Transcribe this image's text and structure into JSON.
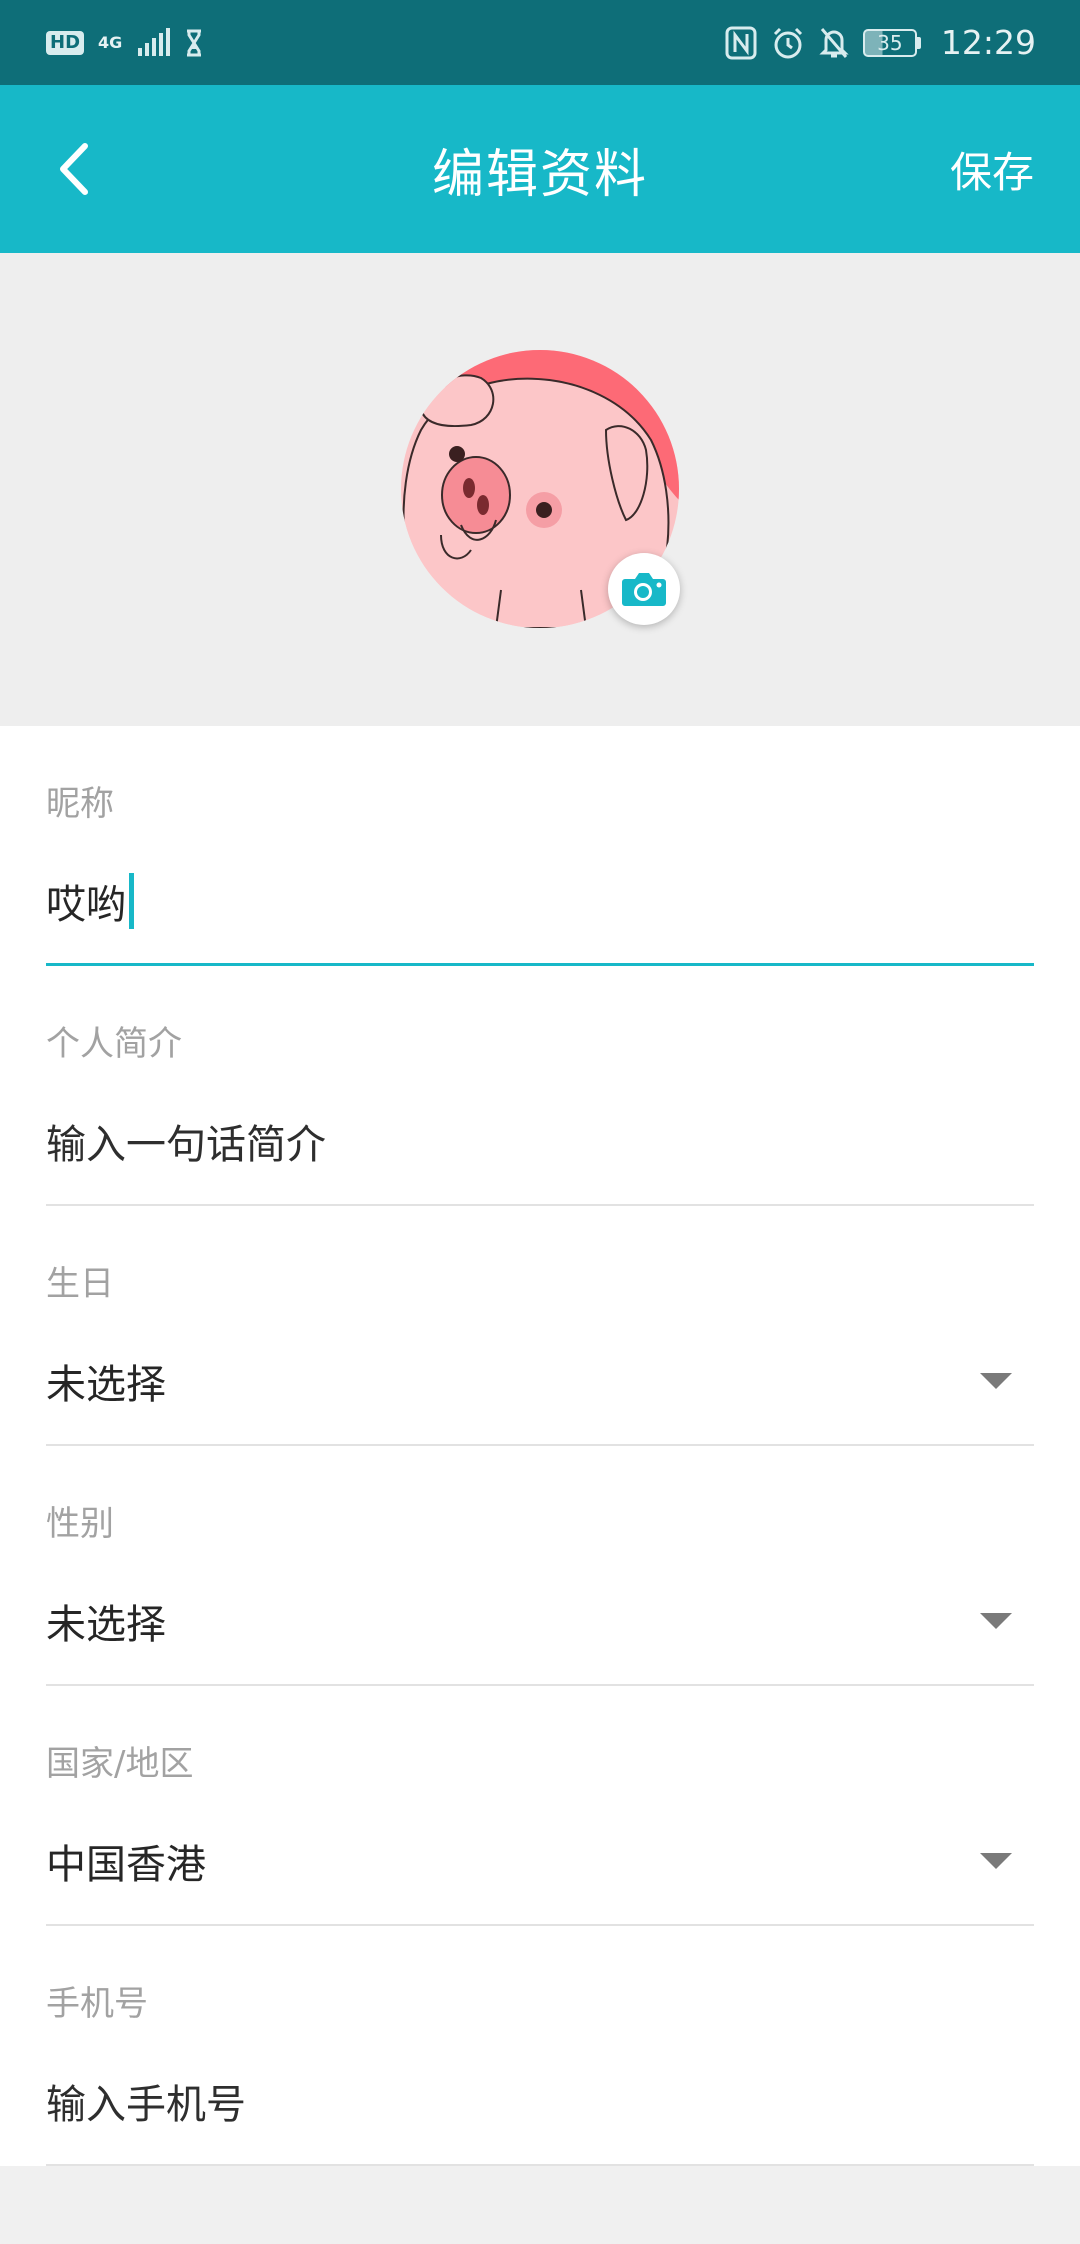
{
  "status_bar": {
    "hd_label": "HD",
    "network_label": "4G",
    "battery_level": "35",
    "time": "12:29",
    "icons": [
      "hd-icon",
      "signal-icon",
      "hourglass-icon",
      "nfc-icon",
      "alarm-icon",
      "mute-icon",
      "battery-icon"
    ]
  },
  "header": {
    "title": "编辑资料",
    "save_label": "保存",
    "back_icon": "back-arrow-icon"
  },
  "avatar": {
    "icon": "pig-avatar",
    "camera_icon": "camera-icon"
  },
  "form": {
    "fields": [
      {
        "label": "昵称",
        "value": "哎哟",
        "kind": "text-input",
        "focused": true
      },
      {
        "label": "个人简介",
        "placeholder": "输入一句话简介",
        "kind": "text-input"
      },
      {
        "label": "生日",
        "value": "未选择",
        "kind": "dropdown"
      },
      {
        "label": "性别",
        "value": "未选择",
        "kind": "dropdown"
      },
      {
        "label": "国家/地区",
        "value": "中国香港",
        "kind": "dropdown"
      },
      {
        "label": "手机号",
        "placeholder": "输入手机号",
        "kind": "text-input"
      }
    ]
  },
  "colors": {
    "status_bar": "#0e6e78",
    "accent": "#17b8c8",
    "background": "#eeeeee"
  }
}
